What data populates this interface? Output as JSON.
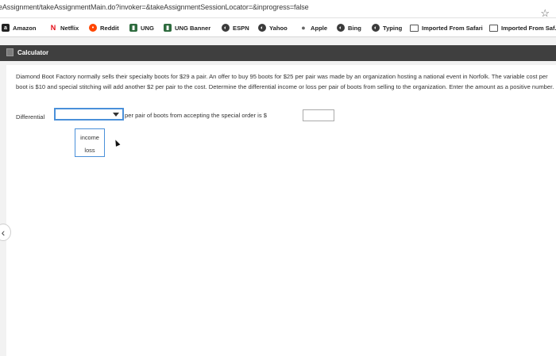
{
  "browser": {
    "url": "eAssignment/takeAssignmentMain.do?invoker=&takeAssignmentSessionLocator=&inprogress=false",
    "bookmarks": [
      {
        "label": "Amazon",
        "icon": "amazon-icon"
      },
      {
        "label": "Netflix",
        "icon": "netflix-icon"
      },
      {
        "label": "Reddit",
        "icon": "reddit-icon"
      },
      {
        "label": "UNG",
        "icon": "ung-icon"
      },
      {
        "label": "UNG Banner",
        "icon": "ung-banner-icon"
      },
      {
        "label": "ESPN",
        "icon": "globe-icon"
      },
      {
        "label": "Yahoo",
        "icon": "globe-icon"
      },
      {
        "label": "Apple",
        "icon": "apple-icon"
      },
      {
        "label": "Bing",
        "icon": "globe-icon"
      },
      {
        "label": "Typing",
        "icon": "globe-icon"
      },
      {
        "label": "Imported From Safari",
        "icon": "folder-icon"
      },
      {
        "label": "Imported From Saf...",
        "icon": "folder-icon"
      }
    ]
  },
  "toolbar": {
    "calculator_label": "Calculator"
  },
  "question": {
    "text": "Diamond Boot Factory normally sells their specialty boots for $29 a pair. An offer to buy 95 boots for $25 per pair was made by an organization hosting a national event in Norfolk. The variable cost per boot is $10 and special stitching will add another $2 per pair to the cost. Determine the differential income or loss per pair of boots from selling to the organization. Enter the amount as a positive number."
  },
  "answer_row": {
    "label": "Differential",
    "suffix": "per pair of boots from accepting the special order is $",
    "dropdown_options": [
      "income",
      "loss"
    ]
  }
}
